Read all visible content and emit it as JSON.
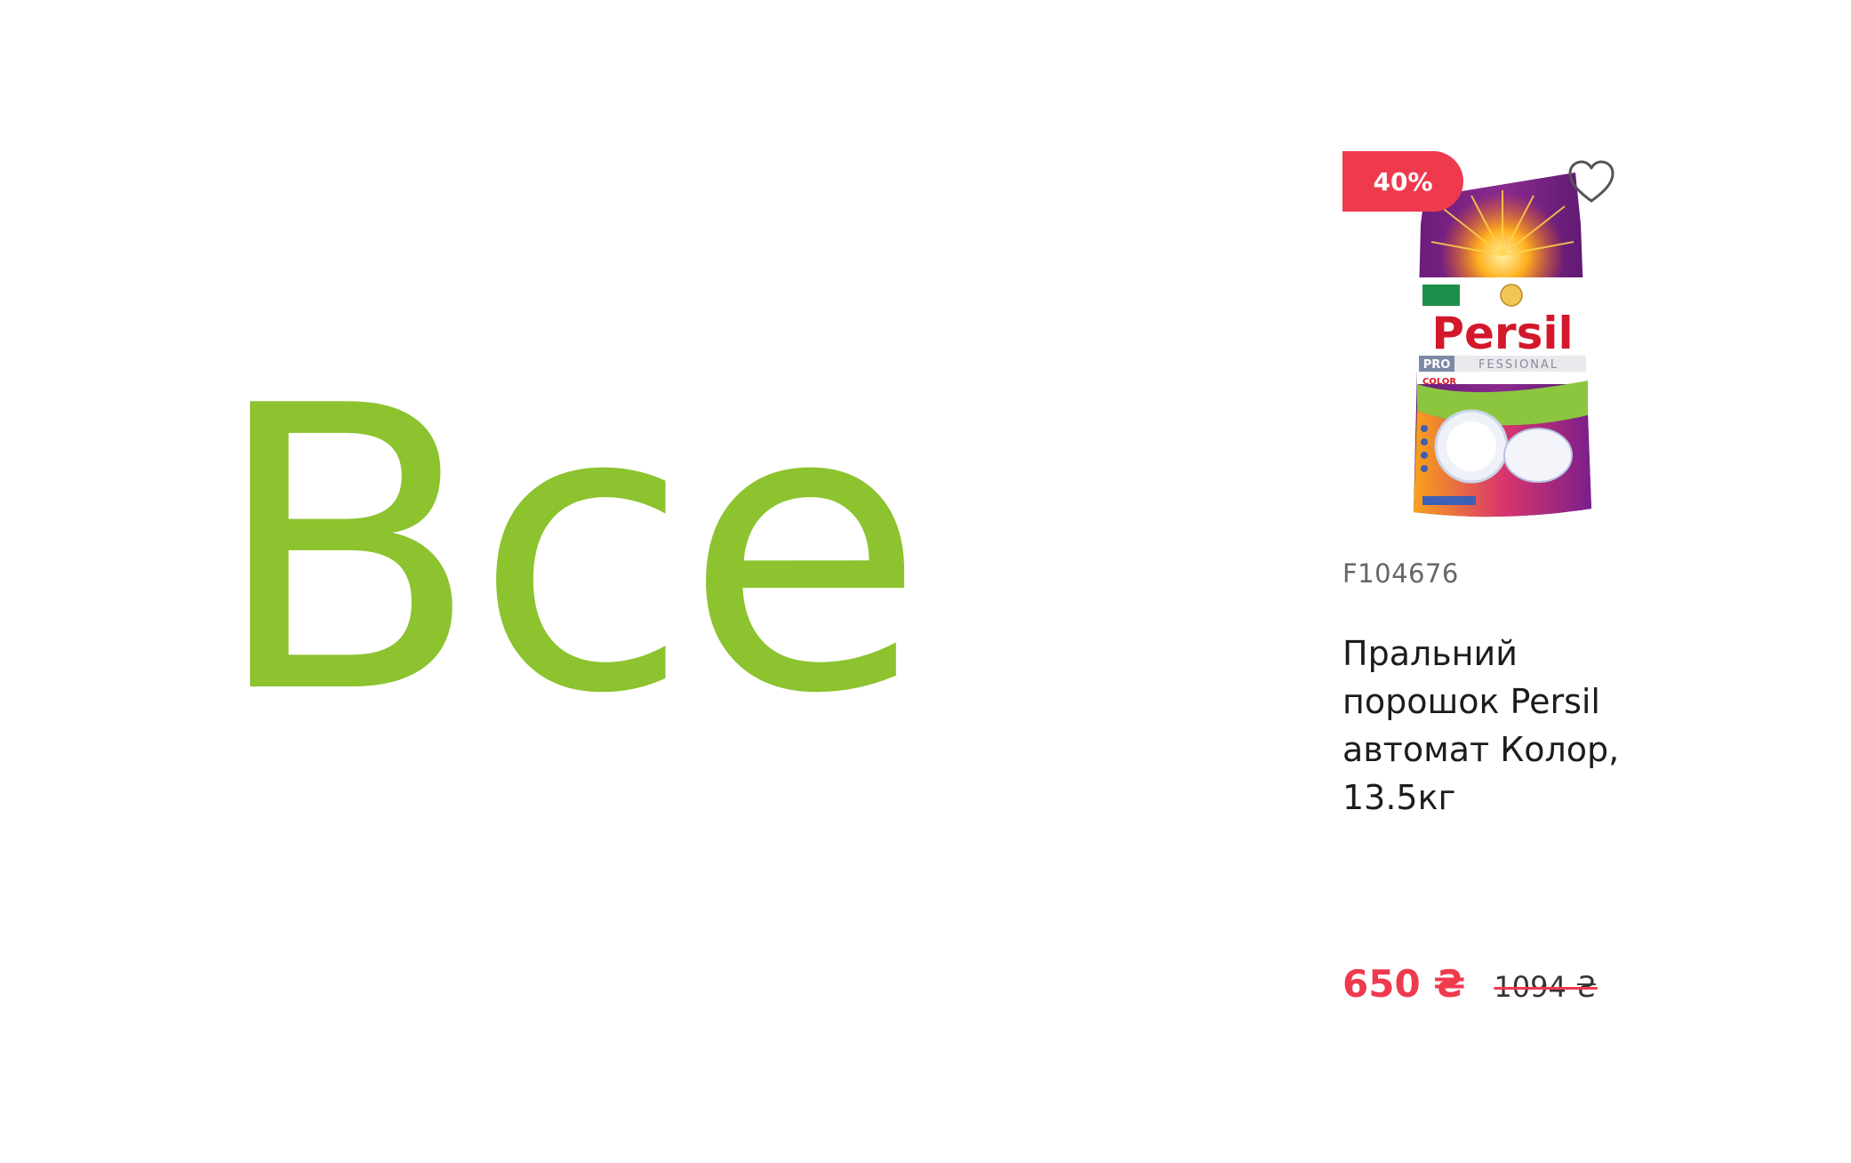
{
  "hero": {
    "title": "Все",
    "color": "#8cc32e"
  },
  "product": {
    "discount": "40%",
    "sku": "F104676",
    "name": "Пральний порошок Persil автомат Колор, 13.5кг",
    "price_current": "650 ₴",
    "price_old": "1094 ₴",
    "image_label": {
      "brand": "Persil",
      "pro": "PRO",
      "fessional": "FESSIONAL",
      "variant": "COLOR"
    },
    "wishlist_icon": "heart-outline-icon",
    "accent_color": "#ef3a4e"
  }
}
